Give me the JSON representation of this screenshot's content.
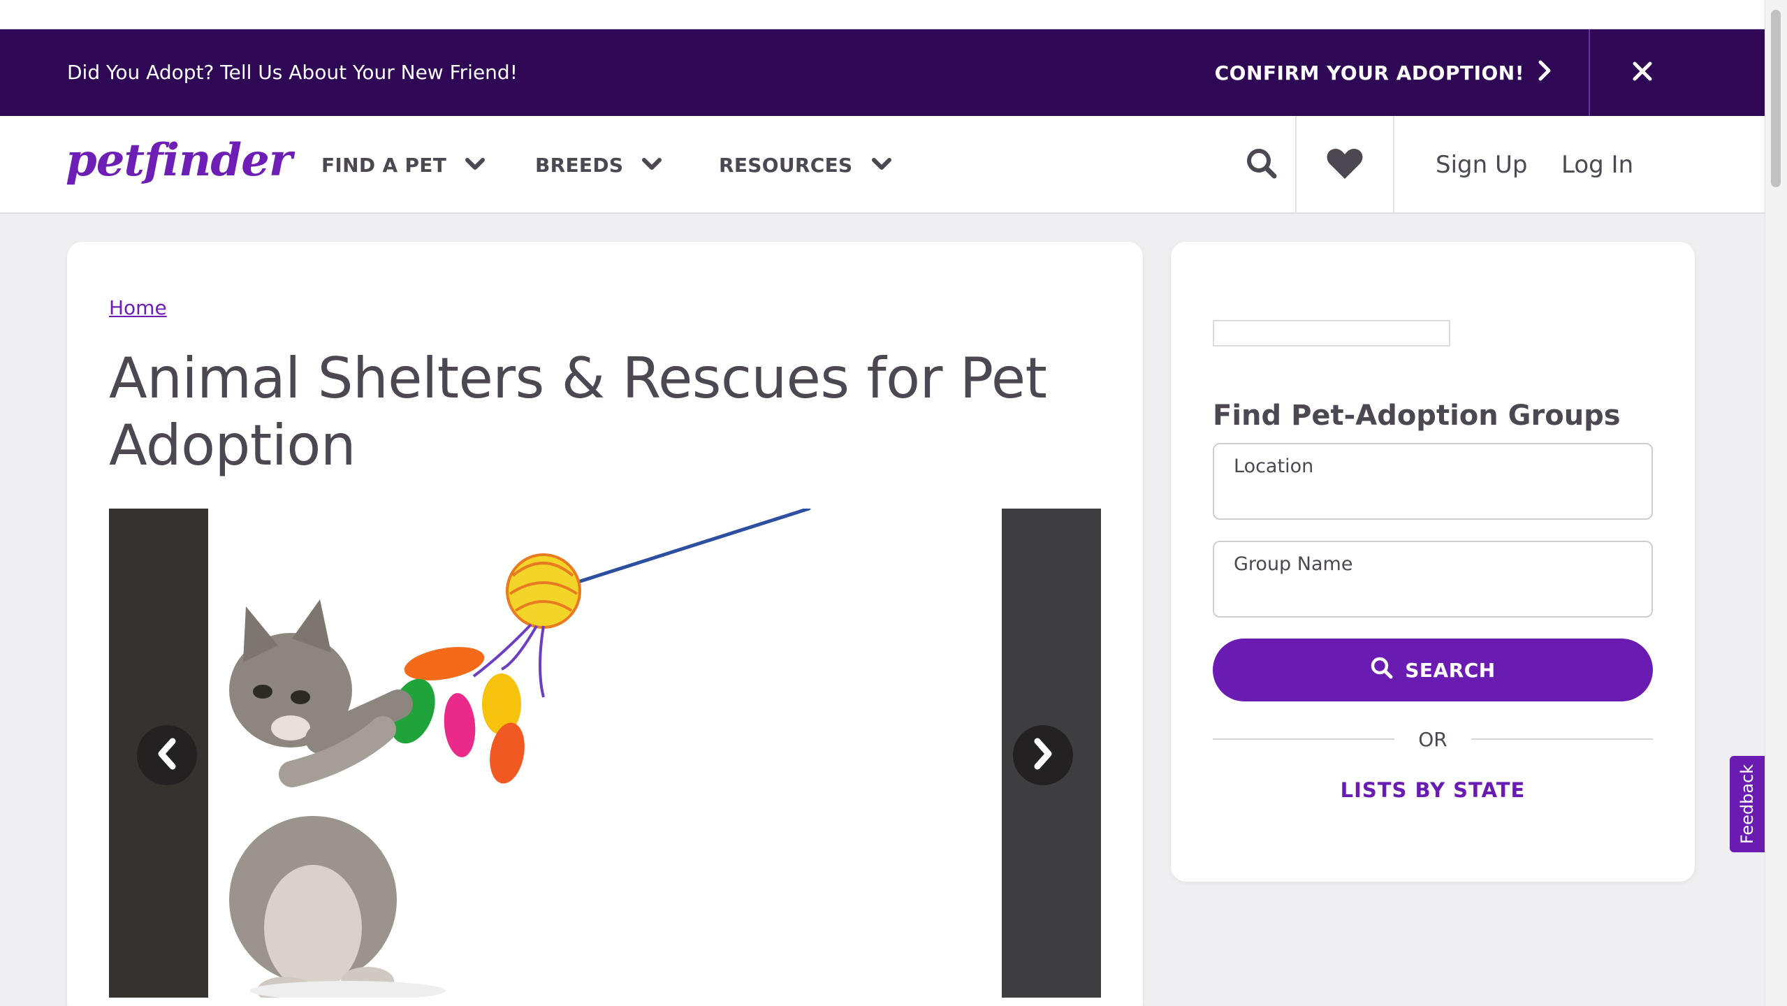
{
  "banner": {
    "message": "Did You Adopt? Tell Us About Your New Friend!",
    "cta_label": "CONFIRM YOUR ADOPTION!",
    "close_icon": "close-icon"
  },
  "navbar": {
    "logo_text": "petfinder",
    "menu": [
      {
        "label": "FIND A PET"
      },
      {
        "label": "BREEDS"
      },
      {
        "label": "RESOURCES"
      }
    ],
    "search_icon": "search-icon",
    "favorites_icon": "heart-icon",
    "signup_label": "Sign Up",
    "login_label": "Log In"
  },
  "main": {
    "breadcrumb": "Home",
    "title": "Animal Shelters & Rescues for Pet Adoption",
    "carousel": {
      "prev_icon": "chevron-left-icon",
      "next_icon": "chevron-right-icon"
    }
  },
  "sidebar": {
    "heading": "Find Pet-Adoption Groups",
    "location_label": "Location",
    "location_value": "",
    "group_label": "Group Name",
    "group_value": "",
    "search_label": "SEARCH",
    "or_text": "OR",
    "lists_link": "LISTS BY STATE"
  },
  "feedback_label": "Feedback",
  "colors": {
    "brand_purple": "#6a1cb2",
    "banner_bg": "#2f0855",
    "page_bg": "#efeff1",
    "text": "#4d4751"
  }
}
